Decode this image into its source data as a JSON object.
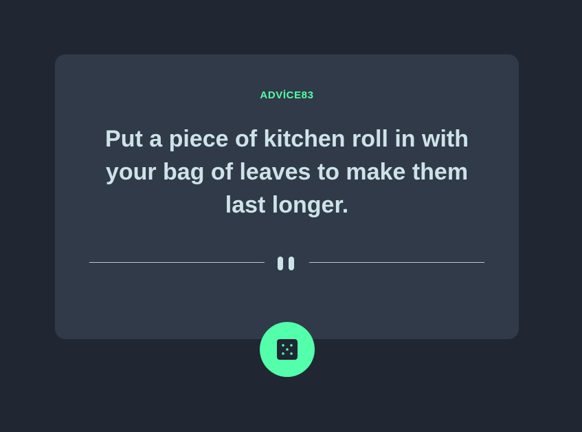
{
  "card": {
    "advice_label": "ADVİCE83",
    "advice_text": "Put a piece of kitchen roll in with your bag of leaves to make them last longer."
  },
  "divider": {
    "icon": "pause-icon"
  },
  "dice_button": {
    "icon": "dice-icon"
  },
  "colors": {
    "background": "#202632",
    "card": "#313a48",
    "accent": "#53ffaa",
    "text": "#cee3e9"
  }
}
